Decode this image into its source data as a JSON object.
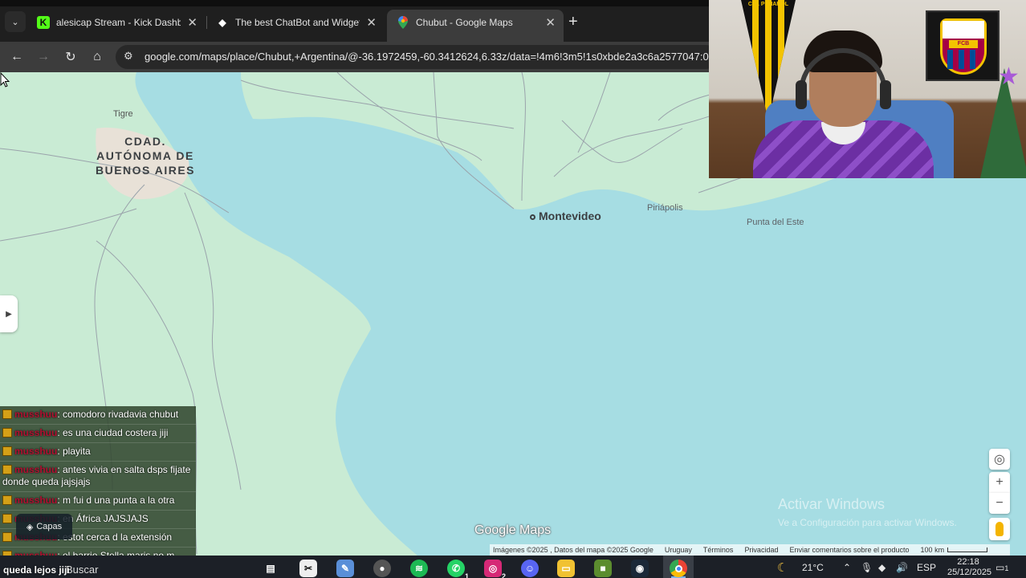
{
  "browser": {
    "tabs": [
      {
        "title": "alesicap Stream - Kick Dashboa",
        "icon": "kick-icon",
        "active": false
      },
      {
        "title": "The best ChatBot and Widgets",
        "icon": "botrix-icon",
        "active": false
      },
      {
        "title": "Chubut - Google Maps",
        "icon": "google-maps-icon",
        "active": true
      }
    ],
    "url": "google.com/maps/place/Chubut,+Argentina/@-36.1972459,-60.3412624,6.33z/data=!4m6!3m5!1s0xbde2a3c6a2577047:0"
  },
  "map": {
    "labels": {
      "tigre": "Tigre",
      "caba": [
        "CDAD.",
        "AUTÓNOMA DE",
        "BUENOS AIRES"
      ],
      "montevideo": "Montevideo",
      "piriapolis": "Piriápolis",
      "punta_del_este": "Punta del Este"
    },
    "layers_button": "Capas",
    "logo": "Google Maps",
    "attribution": {
      "images": "Imágenes ©2025 , Datos del mapa ©2025 Google",
      "country": "Uruguay",
      "terms": "Términos",
      "privacy": "Privacidad",
      "feedback": "Enviar comentarios sobre el producto",
      "scale": "100 km"
    },
    "watermark": {
      "title": "Activar Windows",
      "subtitle": "Ve a Configuración para activar Windows."
    },
    "colors": {
      "water": "#a6dde3",
      "land": "#c9ebd4"
    }
  },
  "webcam": {
    "pennant_text": "C.A. PEÑAROL",
    "crest_text": "FCB"
  },
  "chat": [
    {
      "user": "musshuu",
      "text": ": comodoro rivadavia chubut"
    },
    {
      "user": "musshuu",
      "text": ": es una ciudad costera jiji"
    },
    {
      "user": "musshuu",
      "text": ": playita"
    },
    {
      "user": "musshuu",
      "text": ": antes vivia en salta dsps fijate donde queda jajsjajs"
    },
    {
      "user": "musshuu",
      "text": ": m fui d una punta a la otra"
    },
    {
      "user": "musshuu",
      "text": ": en África JAJSJAJS"
    },
    {
      "user": "musshuu",
      "text": ": estot cerca d la extensión"
    },
    {
      "user": "musshuu",
      "text": ": el barrio Stella maris no m"
    },
    {
      "user": "",
      "text": "queda lejos jiji"
    }
  ],
  "taskbar": {
    "search": "Buscar",
    "badges": {
      "whatsapp": "1",
      "instagram": "2"
    },
    "weather": "21°C",
    "language": "ESP",
    "time": "22:18",
    "date": "25/12/2025",
    "notifications": "1"
  }
}
